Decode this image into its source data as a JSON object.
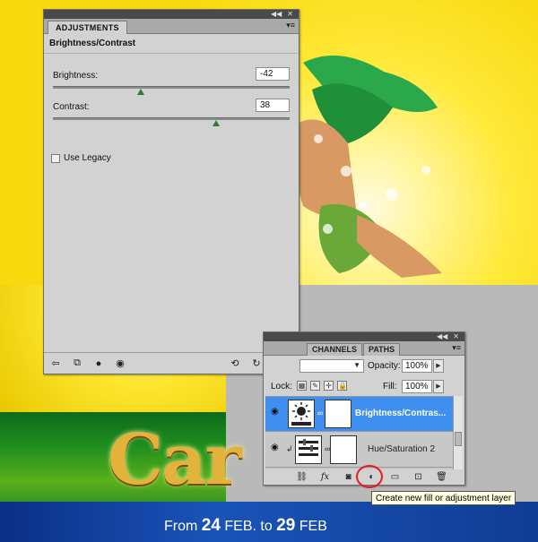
{
  "adjustments": {
    "tab_label": "ADJUSTMENTS",
    "title": "Brightness/Contrast",
    "brightness": {
      "label": "Brightness:",
      "value": "-42",
      "slider_fraction": 0.37
    },
    "contrast": {
      "label": "Contrast:",
      "value": "38",
      "slider_fraction": 0.69
    },
    "legacy_label": "Use Legacy"
  },
  "layers": {
    "tabs": [
      "CHANNELS",
      "PATHS"
    ],
    "opacity_label": "Opacity:",
    "opacity_value": "100%",
    "lock_label": "Lock:",
    "fill_label": "Fill:",
    "fill_value": "100%",
    "items": [
      {
        "name": "Brightness/Contras...",
        "selected": true
      },
      {
        "name": "Hue/Saturation 2",
        "selected": false
      }
    ],
    "bottom_icons": [
      "link-icon",
      "fx-icon",
      "mask-icon",
      "adjustment-layer-icon",
      "group-icon",
      "new-layer-icon",
      "trash-icon"
    ]
  },
  "tooltip": "Create new fill or adjustment layer",
  "artwork": {
    "title_fragment": "Car",
    "date_from": "From",
    "date_day1": "24",
    "date_month1": "FEB. to",
    "date_day2": "29",
    "date_month2": "FEB"
  },
  "colors": {
    "selection": "#3e8ff0",
    "highlight_circle": "#e51a1a",
    "slider_thumb": "#2e7d32"
  }
}
